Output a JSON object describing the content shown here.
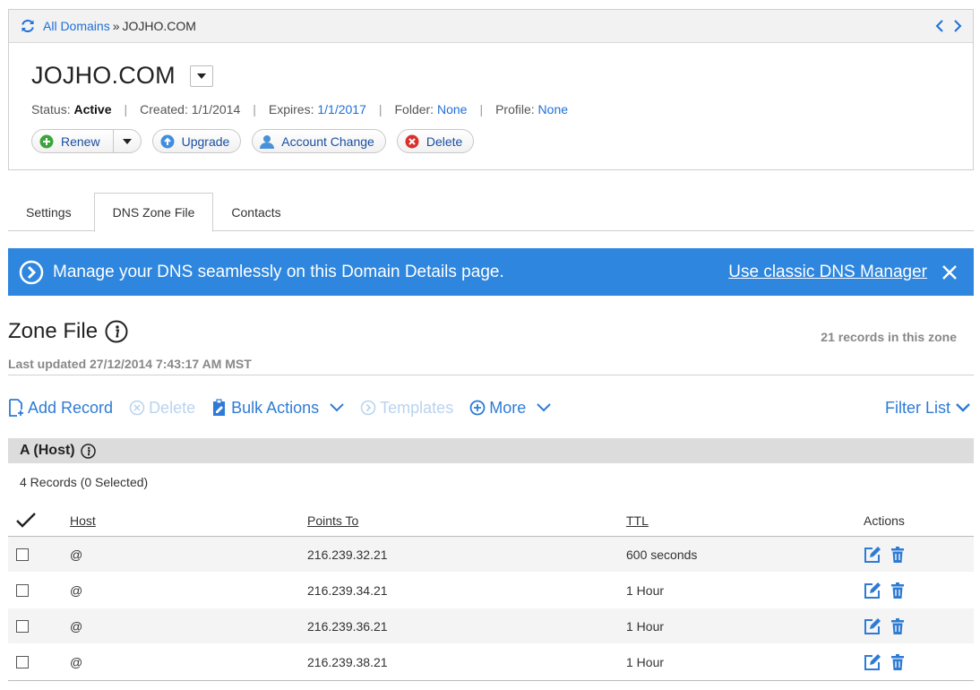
{
  "breadcrumb": {
    "root_label": "All Domains",
    "separator": "»",
    "current": "JOJHO.COM"
  },
  "domain": {
    "title": "JOJHO.COM",
    "status_label": "Status:",
    "status_value": "Active",
    "created_label": "Created:",
    "created_value": "1/1/2014",
    "expires_label": "Expires:",
    "expires_value": "1/1/2017",
    "folder_label": "Folder:",
    "folder_value": "None",
    "profile_label": "Profile:",
    "profile_value": "None",
    "divider": "|"
  },
  "actions": {
    "renew": "Renew",
    "upgrade": "Upgrade",
    "account_change": "Account Change",
    "delete": "Delete"
  },
  "tabs": [
    {
      "label": "Settings",
      "active": false
    },
    {
      "label": "DNS Zone File",
      "active": true
    },
    {
      "label": "Contacts",
      "active": false
    }
  ],
  "banner": {
    "message": "Manage your DNS seamlessly on this Domain Details page.",
    "link": "Use classic DNS Manager"
  },
  "zone": {
    "title": "Zone File",
    "records_count": "21 records in this zone",
    "last_updated": "Last updated 27/12/2014 7:43:17 AM MST"
  },
  "toolbar": {
    "add_record": "Add Record",
    "delete": "Delete",
    "bulk_actions": "Bulk Actions",
    "templates": "Templates",
    "more": "More",
    "filter_list": "Filter List"
  },
  "section": {
    "title": "A (Host)",
    "records_selected": "4 Records (0 Selected)"
  },
  "table": {
    "headers": {
      "host": "Host",
      "points_to": "Points To",
      "ttl": "TTL",
      "actions": "Actions"
    },
    "rows": [
      {
        "host": "@",
        "points_to": "216.239.32.21",
        "ttl": "600 seconds"
      },
      {
        "host": "@",
        "points_to": "216.239.34.21",
        "ttl": "1 Hour"
      },
      {
        "host": "@",
        "points_to": "216.239.36.21",
        "ttl": "1 Hour"
      },
      {
        "host": "@",
        "points_to": "216.239.38.21",
        "ttl": "1 Hour"
      }
    ]
  },
  "colors": {
    "accent_blue": "#2e86de",
    "link_blue": "#1e6fd9",
    "disabled_blue": "#b9d3ee",
    "section_gray": "#dcdcdc"
  }
}
